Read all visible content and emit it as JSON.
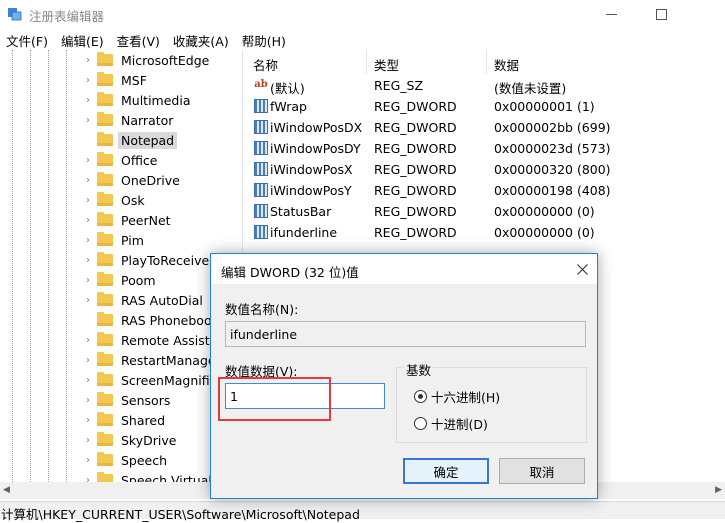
{
  "window": {
    "title": "注册表编辑器",
    "icon": "regedit-icon"
  },
  "caption": {
    "minimize_icon": "minimize-icon",
    "maximize_icon": "maximize-icon"
  },
  "menu": [
    "文件(F)",
    "编辑(E)",
    "查看(V)",
    "收藏夹(A)",
    "帮助(H)"
  ],
  "tree": {
    "items": [
      {
        "label": "MicrosoftEdge",
        "expander": true
      },
      {
        "label": "MSF",
        "expander": true
      },
      {
        "label": "Multimedia",
        "expander": true
      },
      {
        "label": "Narrator",
        "expander": true
      },
      {
        "label": "Notepad",
        "expander": false,
        "selected": true
      },
      {
        "label": "Office",
        "expander": true
      },
      {
        "label": "OneDrive",
        "expander": true
      },
      {
        "label": "Osk",
        "expander": true
      },
      {
        "label": "PeerNet",
        "expander": true
      },
      {
        "label": "Pim",
        "expander": true
      },
      {
        "label": "PlayToReceiver",
        "expander": true
      },
      {
        "label": "Poom",
        "expander": true
      },
      {
        "label": "RAS AutoDial",
        "expander": true
      },
      {
        "label": "RAS Phonebook",
        "expander": false
      },
      {
        "label": "Remote Assistance",
        "expander": true
      },
      {
        "label": "RestartManager",
        "expander": true
      },
      {
        "label": "ScreenMagnifier",
        "expander": true
      },
      {
        "label": "Sensors",
        "expander": true
      },
      {
        "label": "Shared",
        "expander": true
      },
      {
        "label": "SkyDrive",
        "expander": true
      },
      {
        "label": "Speech",
        "expander": true
      },
      {
        "label": "Speech Virtual",
        "expander": true
      }
    ]
  },
  "list": {
    "columns": [
      "名称",
      "类型",
      "数据"
    ],
    "rows": [
      {
        "name": "(默认)",
        "type": "REG_SZ",
        "data": "(数值未设置)",
        "icon": "string-value-icon"
      },
      {
        "name": "fWrap",
        "type": "REG_DWORD",
        "data": "0x00000001 (1)",
        "icon": "binary-value-icon"
      },
      {
        "name": "iWindowPosDX",
        "type": "REG_DWORD",
        "data": "0x000002bb (699)",
        "icon": "binary-value-icon"
      },
      {
        "name": "iWindowPosDY",
        "type": "REG_DWORD",
        "data": "0x0000023d (573)",
        "icon": "binary-value-icon"
      },
      {
        "name": "iWindowPosX",
        "type": "REG_DWORD",
        "data": "0x00000320 (800)",
        "icon": "binary-value-icon"
      },
      {
        "name": "iWindowPosY",
        "type": "REG_DWORD",
        "data": "0x00000198 (408)",
        "icon": "binary-value-icon"
      },
      {
        "name": "StatusBar",
        "type": "REG_DWORD",
        "data": "0x00000000 (0)",
        "icon": "binary-value-icon"
      },
      {
        "name": "ifunderline",
        "type": "REG_DWORD",
        "data": "0x00000000 (0)",
        "icon": "binary-value-icon"
      }
    ]
  },
  "statusbar": {
    "path": "计算机\\HKEY_CURRENT_USER\\Software\\Microsoft\\Notepad"
  },
  "dialog": {
    "title": "编辑 DWORD (32 位)值",
    "value_name_label": "数值名称(N):",
    "value_name": "ifunderline",
    "value_data_label": "数值数据(V):",
    "value_data": "1",
    "base_label": "基数",
    "base_options": [
      {
        "label": "十六进制(H)",
        "checked": true
      },
      {
        "label": "十进制(D)",
        "checked": false
      }
    ],
    "ok_label": "确定",
    "cancel_label": "取消",
    "highlight_color": "#e33b3b"
  }
}
